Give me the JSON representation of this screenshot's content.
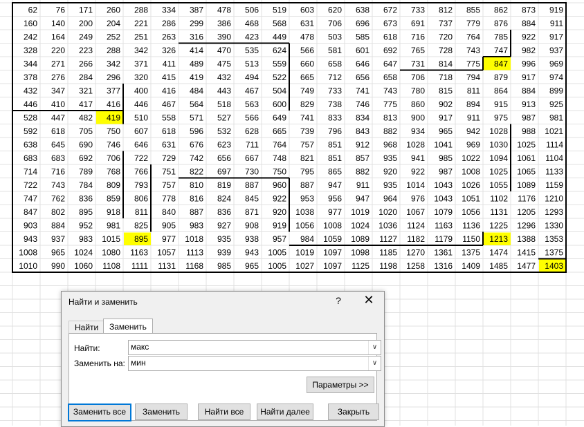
{
  "grid": {
    "rows": [
      [
        62,
        76,
        171,
        260,
        288,
        334,
        387,
        478,
        506,
        519,
        603,
        620,
        638,
        672,
        733,
        812,
        855,
        862,
        873,
        919
      ],
      [
        160,
        140,
        200,
        204,
        221,
        286,
        299,
        386,
        468,
        568,
        631,
        706,
        696,
        673,
        691,
        737,
        779,
        876,
        884,
        911
      ],
      [
        242,
        164,
        249,
        252,
        251,
        263,
        316,
        390,
        423,
        449,
        478,
        503,
        585,
        618,
        716,
        720,
        764,
        785,
        922,
        917
      ],
      [
        328,
        220,
        223,
        288,
        342,
        326,
        414,
        470,
        535,
        624,
        566,
        581,
        601,
        692,
        765,
        728,
        743,
        747,
        982,
        937
      ],
      [
        344,
        271,
        266,
        342,
        371,
        411,
        489,
        475,
        513,
        559,
        660,
        658,
        646,
        647,
        731,
        814,
        775,
        847,
        996,
        969
      ],
      [
        378,
        276,
        284,
        296,
        320,
        415,
        419,
        432,
        494,
        522,
        665,
        712,
        656,
        658,
        706,
        718,
        794,
        879,
        917,
        974
      ],
      [
        432,
        347,
        321,
        377,
        400,
        416,
        484,
        443,
        467,
        504,
        749,
        733,
        741,
        743,
        780,
        815,
        811,
        864,
        884,
        899
      ],
      [
        446,
        410,
        417,
        416,
        446,
        467,
        564,
        518,
        563,
        600,
        829,
        738,
        746,
        775,
        860,
        902,
        894,
        915,
        913,
        925
      ],
      [
        528,
        447,
        482,
        419,
        510,
        558,
        571,
        527,
        566,
        649,
        741,
        833,
        834,
        813,
        900,
        917,
        911,
        975,
        987,
        981
      ],
      [
        592,
        618,
        705,
        750,
        607,
        618,
        596,
        532,
        628,
        665,
        739,
        796,
        843,
        882,
        934,
        965,
        942,
        1028,
        988,
        1021
      ],
      [
        638,
        645,
        690,
        746,
        646,
        631,
        676,
        623,
        711,
        764,
        757,
        851,
        912,
        968,
        1028,
        1041,
        969,
        1030,
        1025,
        1114
      ],
      [
        683,
        683,
        692,
        706,
        722,
        729,
        742,
        656,
        667,
        748,
        821,
        851,
        857,
        935,
        941,
        985,
        1022,
        1094,
        1061,
        1104
      ],
      [
        714,
        716,
        789,
        768,
        766,
        751,
        822,
        697,
        730,
        750,
        795,
        865,
        882,
        920,
        922,
        987,
        1008,
        1025,
        1065,
        1133
      ],
      [
        722,
        743,
        784,
        809,
        793,
        757,
        810,
        819,
        887,
        960,
        887,
        947,
        911,
        935,
        1014,
        1043,
        1026,
        1055,
        1089,
        1159
      ],
      [
        747,
        762,
        836,
        859,
        806,
        778,
        816,
        824,
        845,
        922,
        953,
        956,
        947,
        964,
        976,
        1043,
        1051,
        1102,
        1176,
        1210
      ],
      [
        847,
        802,
        895,
        918,
        811,
        840,
        887,
        836,
        871,
        920,
        1038,
        977,
        1019,
        1020,
        1067,
        1079,
        1056,
        1131,
        1205,
        1293
      ],
      [
        903,
        884,
        952,
        981,
        825,
        905,
        983,
        927,
        908,
        919,
        1056,
        1008,
        1024,
        1036,
        1124,
        1163,
        1136,
        1225,
        1296,
        1330
      ],
      [
        943,
        937,
        983,
        1015,
        895,
        977,
        1018,
        935,
        938,
        957,
        984,
        1059,
        1089,
        1127,
        1182,
        1179,
        1150,
        1213,
        1388,
        1353
      ],
      [
        1008,
        965,
        1024,
        1080,
        1163,
        1057,
        1113,
        939,
        943,
        1005,
        1019,
        1097,
        1098,
        1185,
        1270,
        1361,
        1375,
        1474,
        1415,
        1375
      ],
      [
        1010,
        990,
        1060,
        1108,
        1111,
        1131,
        1168,
        985,
        965,
        1005,
        1027,
        1097,
        1125,
        1198,
        1258,
        1316,
        1409,
        1485,
        1477,
        1403
      ]
    ],
    "highlighted": [
      [
        4,
        17
      ],
      [
        8,
        3
      ],
      [
        17,
        4
      ],
      [
        17,
        17
      ],
      [
        19,
        19
      ]
    ],
    "highlight_color": "#ffff00"
  },
  "dialog": {
    "title": "Найти и заменить",
    "help": "?",
    "close": "✕",
    "tabs": [
      "Найти",
      "Заменить"
    ],
    "find_label": "Найти:",
    "find_value": "макс",
    "replace_label": "Заменить на:",
    "replace_value": "мин",
    "dropdown_glyph": "∨",
    "options_button": "Параметры >>",
    "buttons": {
      "replace_all": "Заменить все",
      "replace": "Заменить",
      "find_all": "Найти все",
      "find_next": "Найти далее",
      "close": "Закрыть"
    }
  }
}
